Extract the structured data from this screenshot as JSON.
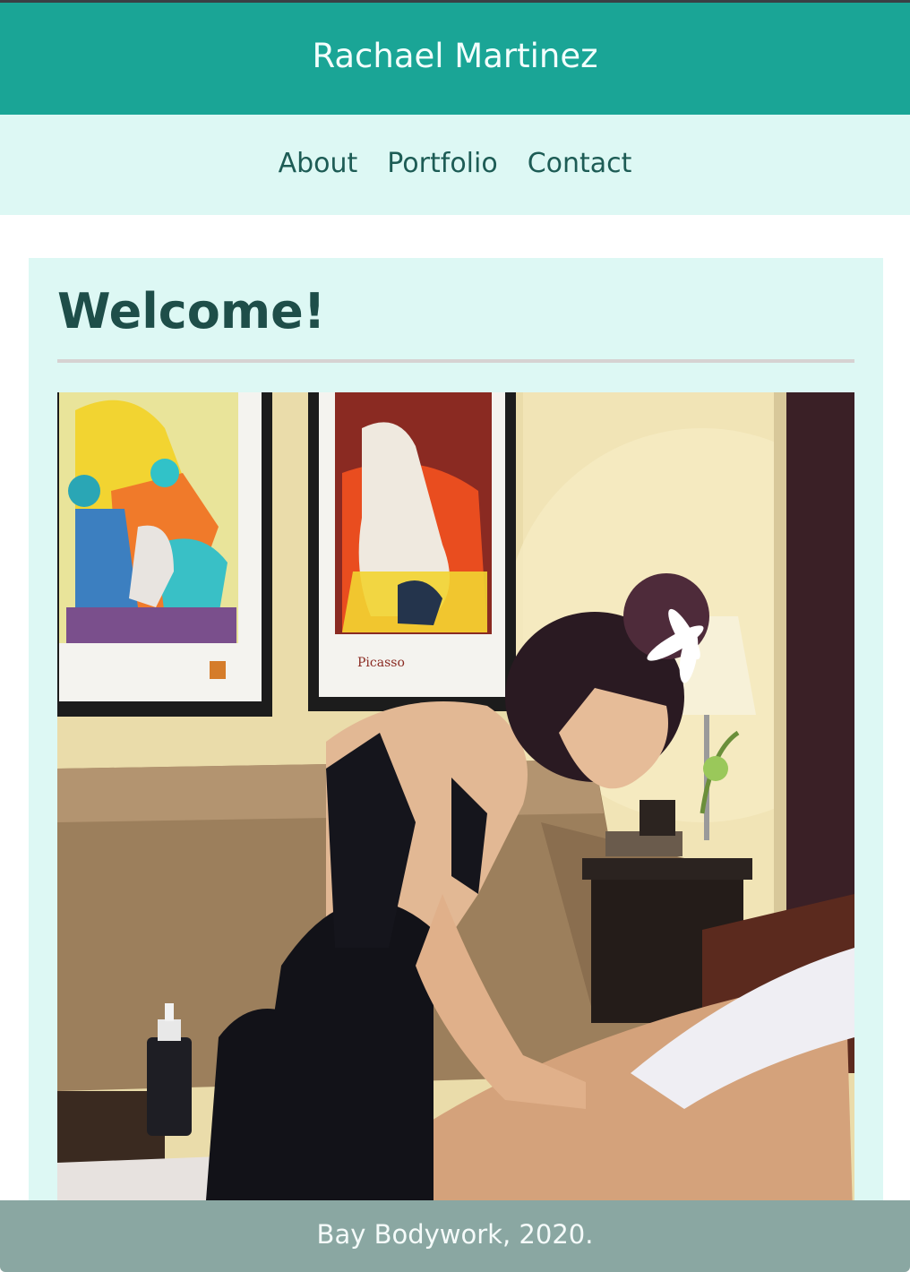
{
  "header": {
    "title": "Rachael Martinez"
  },
  "nav": {
    "items": [
      {
        "label": "About"
      },
      {
        "label": "Portfolio"
      },
      {
        "label": "Contact"
      }
    ]
  },
  "main": {
    "heading": "Welcome!",
    "photo_icon": "photo-massage-therapy"
  },
  "footer": {
    "text": "Bay Bodywork, 2020."
  },
  "colors": {
    "header_bg": "#1aa596",
    "nav_bg": "#ddf8f4",
    "content_bg": "#ddf8f4",
    "footer_bg": "#8aa7a2",
    "heading_text": "#1e4e49",
    "nav_text": "#1d5c55"
  }
}
